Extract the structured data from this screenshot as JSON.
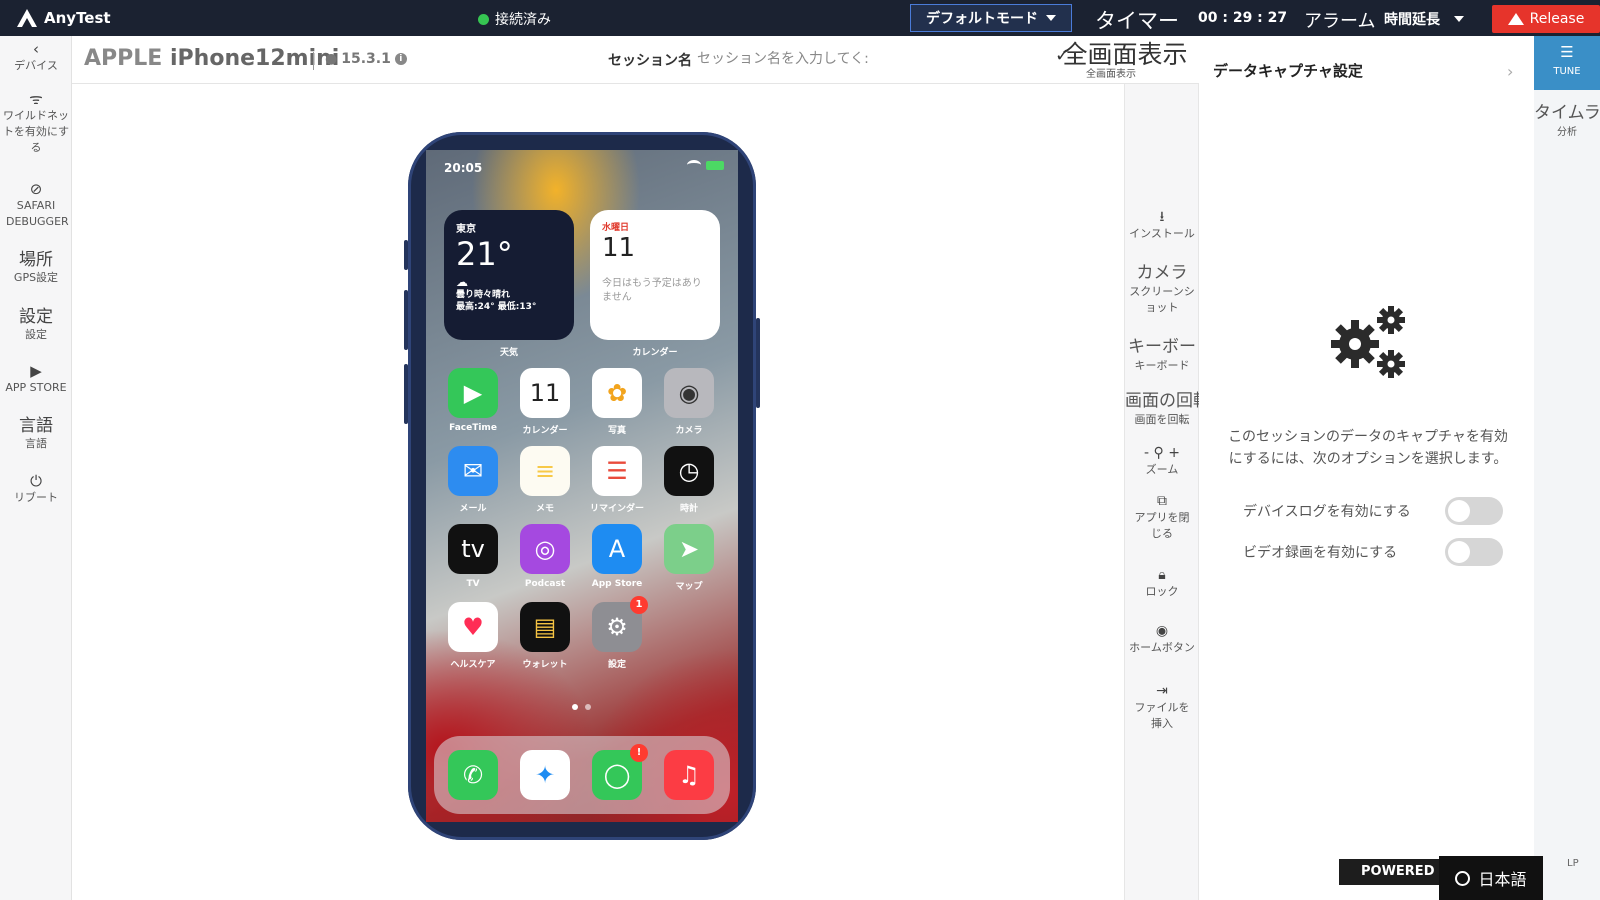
{
  "topbar": {
    "brand": "AnyTest",
    "status": "接続済み",
    "mode": "デフォルトモード",
    "timer_label": "タイマー",
    "timer_value": "00 : 29 : 27",
    "alarm_label": "アラーム",
    "extend_label": "時間延長",
    "release_label": "Release",
    "status_color": "#36c552",
    "release_color": "#e6342b"
  },
  "left_nav": [
    {
      "icon": "chevron-left",
      "glyph": "‹",
      "label": "デバイス"
    },
    {
      "icon": "wifi-antenna",
      "glyph": "ᯤ",
      "label": "ワイルドネットを有効にする"
    },
    {
      "icon": "compass",
      "glyph": "⊘",
      "label": "SAFARI DEBUGGER"
    },
    {
      "big": "場所",
      "label": "GPS設定"
    },
    {
      "big": "設定",
      "label": "設定"
    },
    {
      "icon": "play-circle",
      "glyph": "▶",
      "label": "APP STORE"
    },
    {
      "big": "言語",
      "label": "言語"
    },
    {
      "icon": "power",
      "glyph": "⏻",
      "label": "リブート"
    }
  ],
  "device": {
    "brand": "APPLE",
    "model": "iPhone12mini",
    "os_version": "15.3.1",
    "session_label": "セッション名",
    "session_placeholder": "セッション名を入力してく:",
    "fullscreen_big": "全画面表示",
    "fullscreen_small": "全画面表示"
  },
  "phone": {
    "time": "20:05",
    "weather": {
      "city": "東京",
      "temp": "21°",
      "desc1": "曇り時々晴れ",
      "desc2": "最高:24° 最低:13°",
      "label": "天気"
    },
    "calendar": {
      "day": "水曜日",
      "num": "11",
      "note": "今日はもう予定はありません",
      "label": "カレンダー"
    },
    "apps": [
      {
        "name": "FaceTime",
        "glyph": "▶",
        "bg": "#34c759"
      },
      {
        "name": "カレンダー",
        "glyph": "11",
        "bg": "#ffffff",
        "fg": "#222"
      },
      {
        "name": "写真",
        "glyph": "✿",
        "bg": "#ffffff",
        "fg": "#f2a41d"
      },
      {
        "name": "カメラ",
        "glyph": "◉",
        "bg": "#b8b8bd",
        "fg": "#333"
      },
      {
        "name": "メール",
        "glyph": "✉",
        "bg": "#2d8cf0"
      },
      {
        "name": "メモ",
        "glyph": "≡",
        "bg": "#fdfbf2",
        "fg": "#f7c948"
      },
      {
        "name": "リマインダー",
        "glyph": "☰",
        "bg": "#ffffff",
        "fg": "#e94b3c"
      },
      {
        "name": "時計",
        "glyph": "◷",
        "bg": "#111111"
      },
      {
        "name": "TV",
        "glyph": "tv",
        "bg": "#111111"
      },
      {
        "name": "Podcast",
        "glyph": "◎",
        "bg": "#a549e0"
      },
      {
        "name": "App Store",
        "glyph": "A",
        "bg": "#1e8cf2"
      },
      {
        "name": "マップ",
        "glyph": "➤",
        "bg": "#7ccf8a"
      },
      {
        "name": "ヘルスケア",
        "glyph": "♥",
        "bg": "#ffffff",
        "fg": "#ff2d55"
      },
      {
        "name": "ウォレット",
        "glyph": "▤",
        "bg": "#111111",
        "fg": "#f5c343"
      },
      {
        "name": "設定",
        "glyph": "⚙",
        "bg": "#8e8e93",
        "badge": "1"
      }
    ],
    "dock": [
      {
        "name": "phone",
        "glyph": "✆",
        "bg": "#34c759"
      },
      {
        "name": "safari",
        "glyph": "✦",
        "bg": "#ffffff",
        "fg": "#1e8cf2"
      },
      {
        "name": "messages",
        "glyph": "◯",
        "bg": "#34c759",
        "badge": "!"
      },
      {
        "name": "music",
        "glyph": "♫",
        "bg": "#fc3c44"
      }
    ]
  },
  "right_tools": [
    {
      "icon": "download",
      "glyph": "⭳",
      "label": "インストール"
    },
    {
      "big": "カメラ",
      "label": "スクリーンショット"
    },
    {
      "big": "キーボー",
      "label": "キーボード"
    },
    {
      "big": "画面の回転",
      "label": "画面を回転"
    },
    {
      "icon": "zoom",
      "glyph": "- ⚲ +",
      "label": "ズーム"
    },
    {
      "icon": "close-app",
      "glyph": "⧉",
      "label": "アプリを閉じる"
    },
    {
      "icon": "lock",
      "glyph": "🔒︎",
      "label": "ロック"
    },
    {
      "icon": "home-button",
      "glyph": "◉",
      "label": "ホームボタン"
    },
    {
      "icon": "file-insert",
      "glyph": "⇥",
      "label": "ファイルを挿入"
    }
  ],
  "panel": {
    "title": "データキャプチャ設定",
    "description": "このセッションのデータのキャプチャを有効にするには、次のオプションを選択します。",
    "toggles": [
      {
        "label": "デバイスログを有効にする",
        "on": false
      },
      {
        "label": "ビデオ録画を有効にする",
        "on": false
      }
    ]
  },
  "far_right": {
    "tune_label": "TUNE",
    "timeline_big": "タイムラ",
    "timeline_small": "分析"
  },
  "footer": {
    "powered": "POWERED I",
    "language": "日本語",
    "help_fragment": "LP"
  }
}
